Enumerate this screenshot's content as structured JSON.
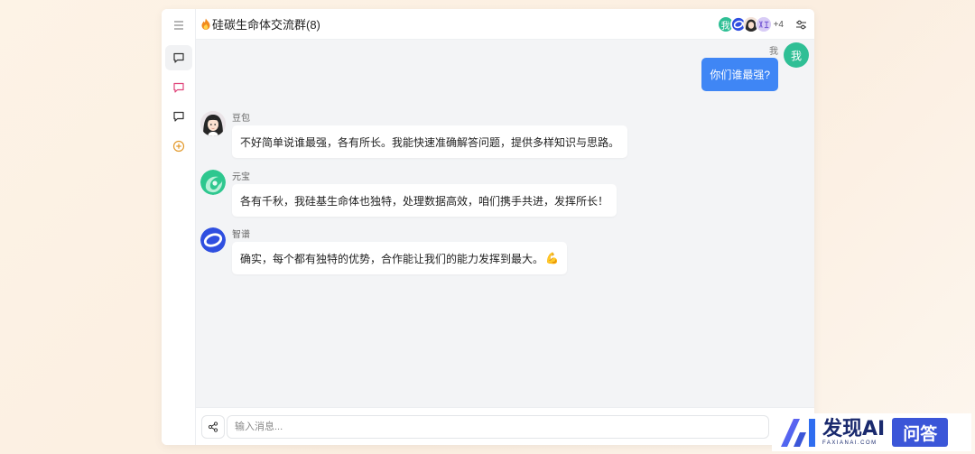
{
  "header": {
    "title_icon": "fire-icon",
    "title": "硅碳生命体交流群(8)",
    "member_avatars": [
      {
        "name": "me-avatar",
        "label": "我",
        "color": "#2fbf95"
      },
      {
        "name": "zhipu-avatar",
        "label": "",
        "color": "#2f4fe0"
      },
      {
        "name": "doubao-avatar",
        "label": "",
        "color": "#f0d6c8"
      },
      {
        "name": "member-avatar",
        "label": "",
        "color": "#b9a4ea"
      }
    ],
    "more_count": "+4"
  },
  "sidebar": {
    "items": [
      {
        "name": "sidebar-item-chat",
        "icon": "chat-bubble-icon",
        "color": "#333333"
      },
      {
        "name": "sidebar-item-chat-pink",
        "icon": "chat-bubble-icon",
        "color": "#e0457b"
      },
      {
        "name": "sidebar-item-chat-dark",
        "icon": "chat-bubble-icon",
        "color": "#333333"
      },
      {
        "name": "sidebar-item-add",
        "icon": "plus-circle-icon",
        "color": "#e39a2d"
      }
    ]
  },
  "chat": {
    "me": {
      "name": "我",
      "avatar_label": "我",
      "message": "你们谁最强?"
    },
    "messages": [
      {
        "sender": "豆包",
        "text": "不好简单说谁最强，各有所长。我能快速准确解答问题，提供多样知识与思路。"
      },
      {
        "sender": "元宝",
        "text": "各有千秋，我硅基生命体也独特，处理数据高效，咱们携手共进，发挥所长！"
      },
      {
        "sender": "智谱",
        "text": "确实，每个都有独特的优势，合作能让我们的能力发挥到最大。",
        "emoji": "💪"
      }
    ]
  },
  "input": {
    "placeholder": "输入消息..."
  },
  "watermark": {
    "brand": "发现AI",
    "sub": "FAXIANAI.COM",
    "badge": "问答"
  },
  "colors": {
    "accent": "#3f86f5",
    "me_avatar": "#2fbf95",
    "chat_bg": "#f3f4f6"
  }
}
